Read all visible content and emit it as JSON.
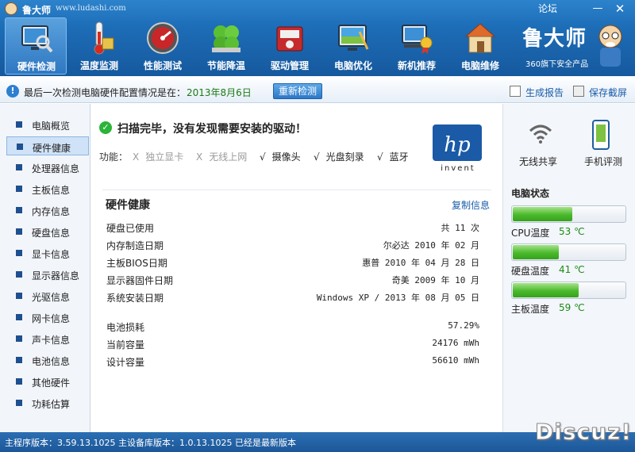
{
  "app": {
    "title": "鲁大师",
    "url": "www.ludashi.com",
    "forum_label": "论坛",
    "minimize_glyph": "—",
    "close_glyph": "✕"
  },
  "toolbar": {
    "items": [
      {
        "label": "硬件检测",
        "icon": "monitor-magnifier-icon",
        "active": true
      },
      {
        "label": "温度监测",
        "icon": "thermometer-icon",
        "active": false
      },
      {
        "label": "性能测试",
        "icon": "speedometer-icon",
        "active": false
      },
      {
        "label": "节能降温",
        "icon": "clover-icon",
        "active": false
      },
      {
        "label": "驱动管理",
        "icon": "driver-box-icon",
        "active": false
      },
      {
        "label": "电脑优化",
        "icon": "monitor-broom-icon",
        "active": false
      },
      {
        "label": "新机推荐",
        "icon": "new-pc-medal-icon",
        "active": false
      },
      {
        "label": "电脑维修",
        "icon": "house-repair-icon",
        "active": false
      }
    ]
  },
  "brand": {
    "name": "鲁大师",
    "subtitle": "360旗下安全产品"
  },
  "infobar": {
    "text": "最后一次检测电脑硬件配置情况是在：",
    "date": "2013年8月6日",
    "redetect_label": "重新检测",
    "report_label": "生成报告",
    "screenshot_label": "保存截屏"
  },
  "sidebar": {
    "items": [
      {
        "label": "电脑概览",
        "active": false
      },
      {
        "label": "硬件健康",
        "active": true
      },
      {
        "label": "处理器信息",
        "active": false
      },
      {
        "label": "主板信息",
        "active": false
      },
      {
        "label": "内存信息",
        "active": false
      },
      {
        "label": "硬盘信息",
        "active": false
      },
      {
        "label": "显卡信息",
        "active": false
      },
      {
        "label": "显示器信息",
        "active": false
      },
      {
        "label": "光驱信息",
        "active": false
      },
      {
        "label": "网卡信息",
        "active": false
      },
      {
        "label": "声卡信息",
        "active": false
      },
      {
        "label": "电池信息",
        "active": false
      },
      {
        "label": "其他硬件",
        "active": false
      },
      {
        "label": "功耗估算",
        "active": false
      }
    ]
  },
  "main": {
    "scan_title": "扫描完毕，没有发现需要安装的驱动！",
    "features_label": "功能：",
    "features": [
      {
        "mark": "X",
        "label": "独立显卡",
        "available": false
      },
      {
        "mark": "X",
        "label": "无线上网",
        "available": false
      },
      {
        "mark": "√",
        "label": "摄像头",
        "available": true
      },
      {
        "mark": "√",
        "label": "光盘刻录",
        "available": true
      },
      {
        "mark": "√",
        "label": "蓝牙",
        "available": true
      }
    ],
    "vendor_logo_text": "hp",
    "vendor_tagline": "invent",
    "section_title": "硬件健康",
    "copy_label": "复制信息",
    "rows": [
      {
        "label": "硬盘已使用",
        "value": "共 11 次"
      },
      {
        "label": "内存制造日期",
        "value": "尔必达 2010 年 02 月"
      },
      {
        "label": "主板BIOS日期",
        "value": "惠普 2010 年 04 月 28 日"
      },
      {
        "label": "显示器固件日期",
        "value": "奇美 2009 年 10 月"
      },
      {
        "label": "系统安装日期",
        "value": "Windows XP / 2013 年 08 月 05 日"
      },
      {
        "label": "电池损耗",
        "value": "57.29%"
      },
      {
        "label": "当前容量",
        "value": "24176 mWh"
      },
      {
        "label": "设计容量",
        "value": "56610 mWh"
      }
    ]
  },
  "right": {
    "wifi_share_label": "无线共享",
    "phone_eval_label": "手机评测",
    "status_title": "电脑状态",
    "meters": [
      {
        "label": "CPU温度",
        "value": "53 ℃",
        "fill": 0.53
      },
      {
        "label": "硬盘温度",
        "value": "41 ℃",
        "fill": 0.41
      },
      {
        "label": "主板温度",
        "value": "59 ℃",
        "fill": 0.59
      }
    ]
  },
  "statusbar": {
    "text": "主程序版本：3.59.13.1025  主设备库版本：1.0.13.1025  已经是最新版本"
  },
  "watermark": "Discuz!",
  "colors": {
    "toolbar_blue": "#1d6db7",
    "accent_green": "#4bb92c",
    "hp_blue": "#1a5aa6",
    "link_blue": "#1a5ca8"
  }
}
